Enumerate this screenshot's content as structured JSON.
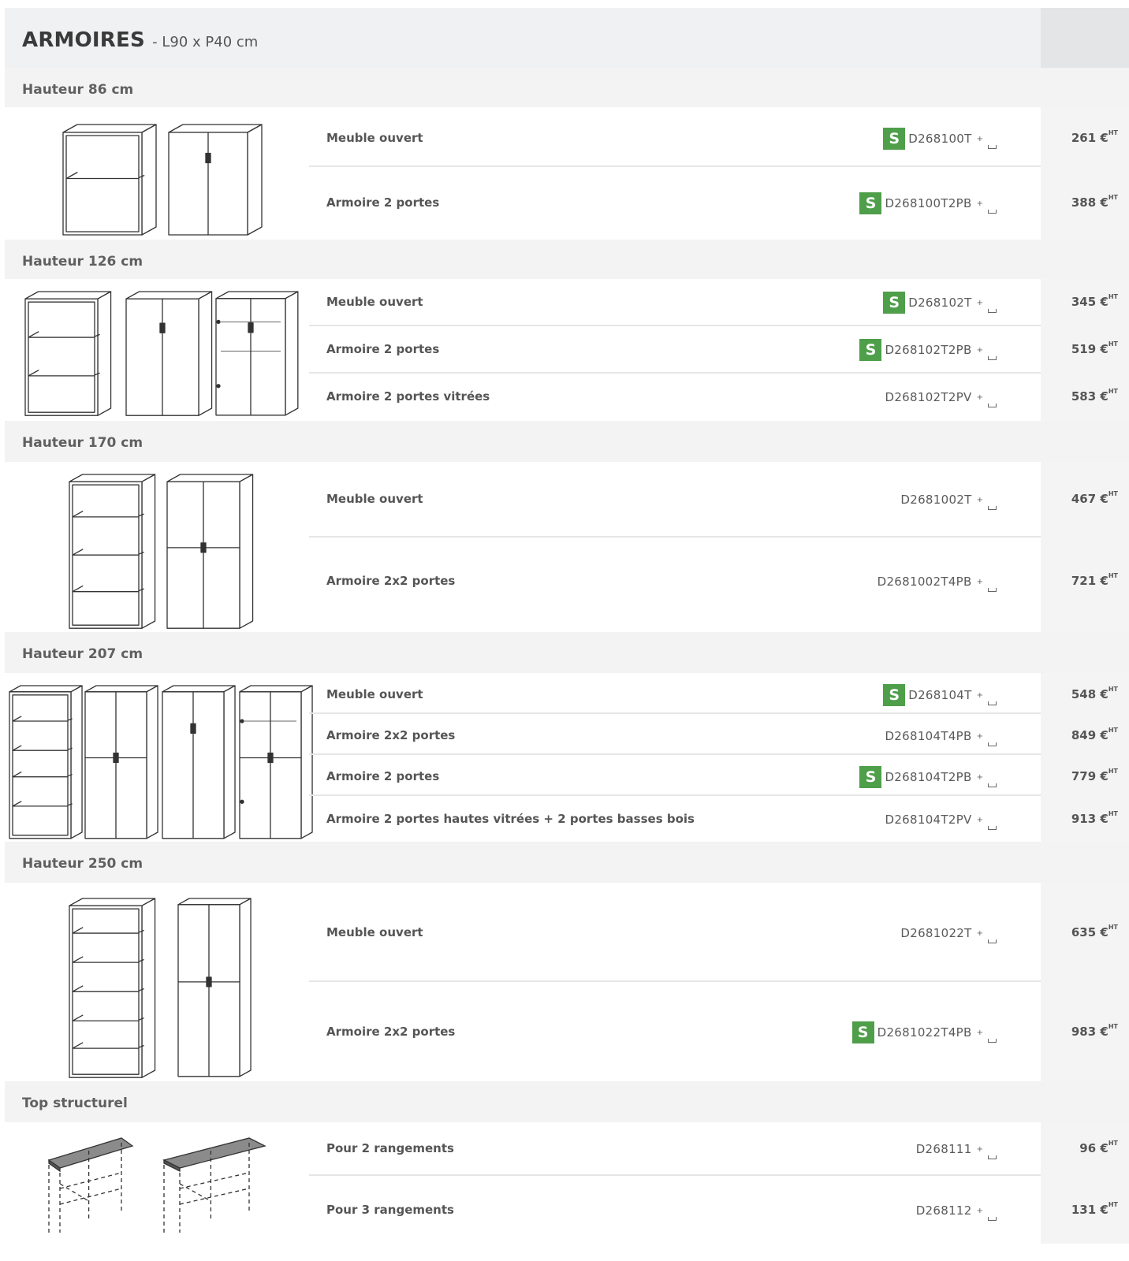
{
  "header": {
    "title": "ARMOIRES",
    "subtitle": "- L90 x P40 cm"
  },
  "badge_label": "S",
  "currency_label": "€",
  "tax_label": "HT",
  "colors": {
    "stock_badge": "#4f9e4a",
    "header_bg": "#f0f1f2",
    "section_bg": "#f3f3f4"
  },
  "sections": [
    {
      "heading": "Hauteur 86 cm",
      "rows": [
        {
          "desc": "Meuble ouvert",
          "ref": "D268100T",
          "stock": true,
          "price": "261"
        },
        {
          "desc": "Armoire 2 portes",
          "ref": "D268100T2PB",
          "stock": true,
          "price": "388"
        }
      ]
    },
    {
      "heading": "Hauteur 126 cm",
      "rows": [
        {
          "desc": "Meuble ouvert",
          "ref": "D268102T",
          "stock": true,
          "price": "345"
        },
        {
          "desc": "Armoire 2 portes",
          "ref": "D268102T2PB",
          "stock": true,
          "price": "519"
        },
        {
          "desc": "Armoire 2 portes vitrées",
          "ref": "D268102T2PV",
          "stock": false,
          "price": "583"
        }
      ]
    },
    {
      "heading": "Hauteur 170 cm",
      "rows": [
        {
          "desc": "Meuble ouvert",
          "ref": "D2681002T",
          "stock": false,
          "price": "467"
        },
        {
          "desc": "Armoire 2x2 portes",
          "ref": "D2681002T4PB",
          "stock": false,
          "price": "721"
        }
      ]
    },
    {
      "heading": "Hauteur 207 cm",
      "rows": [
        {
          "desc": "Meuble ouvert",
          "ref": "D268104T",
          "stock": true,
          "price": "548"
        },
        {
          "desc": "Armoire 2x2 portes",
          "ref": "D268104T4PB",
          "stock": false,
          "price": "849"
        },
        {
          "desc": "Armoire 2 portes",
          "ref": "D268104T2PB",
          "stock": true,
          "price": "779"
        },
        {
          "desc": "Armoire 2 portes hautes vitrées + 2 portes basses bois",
          "ref": "D268104T2PV",
          "stock": false,
          "price": "913"
        }
      ]
    },
    {
      "heading": "Hauteur 250 cm",
      "rows": [
        {
          "desc": "Meuble ouvert",
          "ref": "D2681022T",
          "stock": false,
          "price": "635"
        },
        {
          "desc": "Armoire 2x2 portes",
          "ref": "D2681022T4PB",
          "stock": true,
          "price": "983"
        }
      ]
    },
    {
      "heading": "Top structurel",
      "rows": [
        {
          "desc": "Pour 2 rangements",
          "ref": "D268111",
          "stock": false,
          "price": "96"
        },
        {
          "desc": "Pour 3 rangements",
          "ref": "D268112",
          "stock": false,
          "price": "131"
        }
      ]
    }
  ]
}
